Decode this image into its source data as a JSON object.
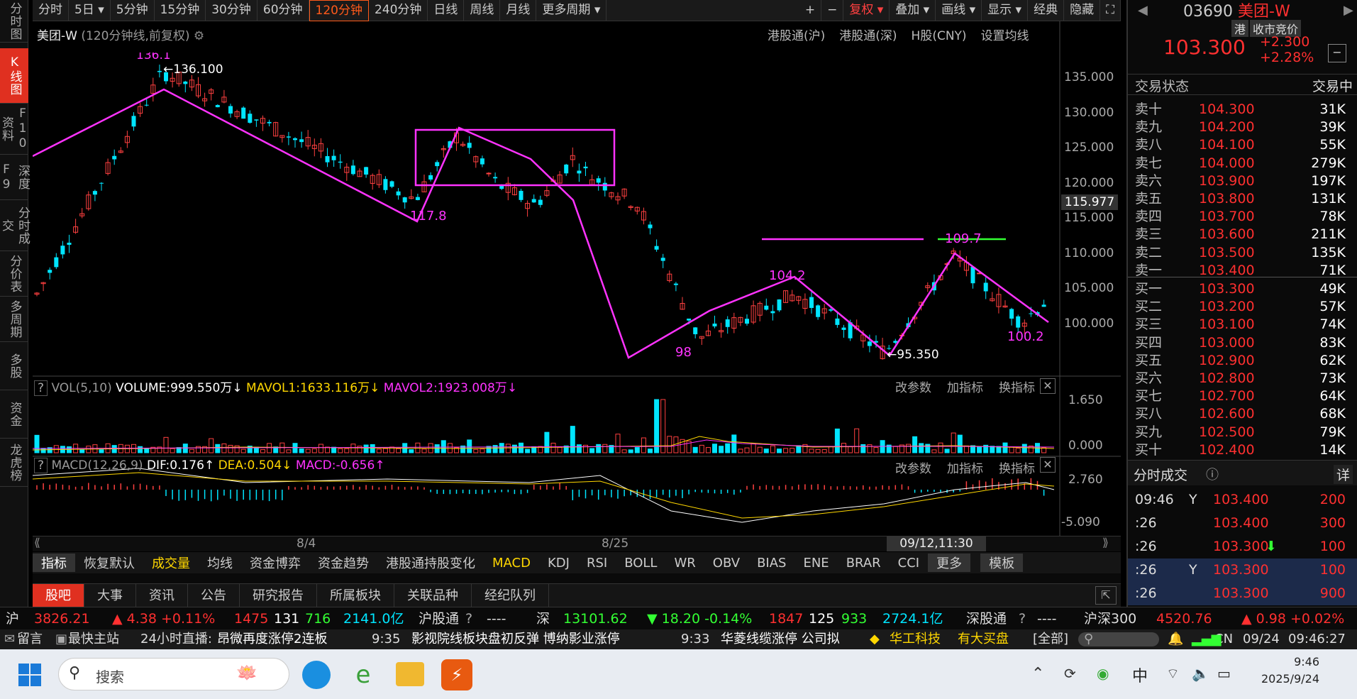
{
  "left_nav": [
    "分时图",
    "K线图",
    "F10资料",
    "深度F9",
    "分时成交",
    "分价表",
    "多周期",
    "多股",
    "资金",
    "龙虎榜"
  ],
  "periods": [
    "分时",
    "5日",
    "5分钟",
    "15分钟",
    "30分钟",
    "60分钟",
    "120分钟",
    "240分钟",
    "日线",
    "周线",
    "月线",
    "更多周期"
  ],
  "toolbar_right": [
    "+",
    "−",
    "复权",
    "叠加",
    "画线",
    "显示",
    "经典",
    "隐藏"
  ],
  "chart_header": {
    "name": "美团-W",
    "info": "(120分钟线,前复权)",
    "links": [
      "港股通(沪)",
      "港股通(深)",
      "H股(CNY)",
      "设置均线"
    ]
  },
  "price_axis": [
    "135.000",
    "130.000",
    "125.000",
    "120.000",
    "115.000",
    "110.000",
    "105.000",
    "100.000"
  ],
  "current_price_label": "115.977",
  "annotations": {
    "high": "136.100",
    "high_partial": "136.1",
    "a": "117.8",
    "b": "98",
    "c": "104.2",
    "d": "95.350",
    "e": "109.7",
    "f": "100.2"
  },
  "vol_header": {
    "name": "VOL(5,10)",
    "volume": "VOLUME:999.550万",
    "ma1": "MAVOL1:1633.116万",
    "ma2": "MAVOL2:1923.008万"
  },
  "vol_axis": [
    "1.650",
    "0.000"
  ],
  "macd_header": {
    "name": "MACD(12,26,9)",
    "dif": "DIF:0.176",
    "dea": "DEA:0.504",
    "macd": "MACD:-0.656"
  },
  "macd_axis": [
    "2.760",
    "-5.090"
  ],
  "pane_links": [
    "改参数",
    "加指标",
    "换指标"
  ],
  "x_axis": {
    "d1": "8/4",
    "d2": "8/25",
    "cursor": "09/12,11:30"
  },
  "indicators": [
    "指标",
    "恢复默认",
    "成交量",
    "均线",
    "资金博弈",
    "资金趋势",
    "港股通持股变化",
    "MACD",
    "KDJ",
    "RSI",
    "BOLL",
    "WR",
    "OBV",
    "BIAS",
    "ENE",
    "BRAR",
    "CCI",
    "更多",
    "模板"
  ],
  "news_tabs": [
    "股吧",
    "大事",
    "资讯",
    "公告",
    "研究报告",
    "所属板块",
    "关联品种",
    "经纪队列"
  ],
  "quote": {
    "code": "03690",
    "name": "美团-W",
    "market": "港",
    "status_tag": "收市竞价",
    "price": "103.300",
    "change": "+2.300",
    "change_pct": "+2.28%",
    "state_label": "交易状态",
    "state": "交易中"
  },
  "order_book": [
    {
      "label": "卖十",
      "price": "104.300",
      "vol": "31K"
    },
    {
      "label": "卖九",
      "price": "104.200",
      "vol": "39K"
    },
    {
      "label": "卖八",
      "price": "104.100",
      "vol": "55K"
    },
    {
      "label": "卖七",
      "price": "104.000",
      "vol": "279K"
    },
    {
      "label": "卖六",
      "price": "103.900",
      "vol": "197K"
    },
    {
      "label": "卖五",
      "price": "103.800",
      "vol": "131K"
    },
    {
      "label": "卖四",
      "price": "103.700",
      "vol": "78K"
    },
    {
      "label": "卖三",
      "price": "103.600",
      "vol": "211K"
    },
    {
      "label": "卖二",
      "price": "103.500",
      "vol": "135K"
    },
    {
      "label": "卖一",
      "price": "103.400",
      "vol": "71K"
    },
    {
      "label": "买一",
      "price": "103.300",
      "vol": "49K"
    },
    {
      "label": "买二",
      "price": "103.200",
      "vol": "57K"
    },
    {
      "label": "买三",
      "price": "103.100",
      "vol": "74K"
    },
    {
      "label": "买四",
      "price": "103.000",
      "vol": "83K"
    },
    {
      "label": "买五",
      "price": "102.900",
      "vol": "62K"
    },
    {
      "label": "买六",
      "price": "102.800",
      "vol": "73K"
    },
    {
      "label": "买七",
      "price": "102.700",
      "vol": "64K"
    },
    {
      "label": "买八",
      "price": "102.600",
      "vol": "68K"
    },
    {
      "label": "买九",
      "price": "102.500",
      "vol": "79K"
    },
    {
      "label": "买十",
      "price": "102.400",
      "vol": "14K"
    }
  ],
  "ticks_header": {
    "title": "分时成交",
    "detail": "详"
  },
  "ticks": [
    {
      "time": "09:46",
      "flag": "Y",
      "price": "103.400",
      "vol": "200"
    },
    {
      "time": ":26",
      "flag": "",
      "price": "103.400",
      "vol": "300"
    },
    {
      "time": ":26",
      "flag": "",
      "price": "103.300",
      "vol": "100"
    },
    {
      "time": ":26",
      "flag": "Y",
      "price": "103.300",
      "vol": "100"
    },
    {
      "time": ":26",
      "flag": "",
      "price": "103.300",
      "vol": "900"
    }
  ],
  "index_bar": {
    "hu_label": "沪",
    "hu_val": "3826.21",
    "hu_chg": "▲ 4.38 +0.11%",
    "hu_n1": "1475",
    "hu_n2": "131",
    "hu_n3": "716",
    "hu_amt": "2141.0亿",
    "hgt": "沪股通",
    "dash": "----",
    "sz_label": "深",
    "sz_val": "13101.62",
    "sz_chg": "▼ 18.20 -0.14%",
    "sz_n1": "1847",
    "sz_n2": "125",
    "sz_n3": "933",
    "sz_amt": "2724.1亿",
    "sgt": "深股通",
    "hs_label": "沪深300",
    "hs_val": "4520.76",
    "hs_chg": "▲ 0.98 +0.02%"
  },
  "ticker": {
    "msg": "留言",
    "main": "最快主站",
    "live": "24小时直播:",
    "n1": "昂微再度涨停2连板",
    "t2": "9:35",
    "n2": "影视院线板块盘初反弹 博纳影业涨停",
    "t3": "9:33",
    "n3": "华菱线缆涨停 公司拟",
    "n4": "华工科技",
    "n5": "有大买盘",
    "all": "[全部]",
    "cn": "CN",
    "date": "09/24",
    "time": "09:46:27"
  },
  "taskbar": {
    "search": "搜索",
    "time": "9:46",
    "date": "2025/9/24",
    "lang": "中"
  }
}
